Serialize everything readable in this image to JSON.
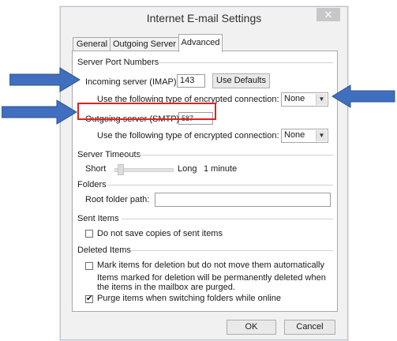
{
  "dialog": {
    "title": "Internet E-mail Settings",
    "close_glyph": "✕",
    "tabs": [
      {
        "label": "General"
      },
      {
        "label": "Outgoing Server"
      },
      {
        "label": "Advanced"
      }
    ],
    "active_tab": "Advanced"
  },
  "server_port_numbers": {
    "section_label": "Server Port Numbers",
    "incoming_label": "Incoming server (IMAP):",
    "incoming_value": "143",
    "use_defaults_label": "Use Defaults",
    "incoming_encryption_label": "Use the following type of encrypted connection:",
    "incoming_encryption_value": "None",
    "outgoing_label": "Outgoing server (SMTP):",
    "outgoing_value": "587",
    "outgoing_encryption_label": "Use the following type of encrypted connection:",
    "outgoing_encryption_value": "None"
  },
  "server_timeouts": {
    "section_label": "Server Timeouts",
    "short_label": "Short",
    "long_label": "Long",
    "value_label": "1 minute"
  },
  "folders": {
    "section_label": "Folders",
    "root_folder_label": "Root folder path:",
    "root_folder_value": ""
  },
  "sent_items": {
    "section_label": "Sent Items",
    "do_not_save_label": "Do not save copies of sent items",
    "do_not_save_checked": false
  },
  "deleted_items": {
    "section_label": "Deleted Items",
    "mark_label": "Mark items for deletion but do not move them automatically",
    "mark_checked": false,
    "note_line1": "Items marked for deletion will be permanently deleted when",
    "note_line2": "the items in the mailbox are purged.",
    "purge_label": "Purge items when switching folders while online",
    "purge_checked": true,
    "check_glyph": "✔"
  },
  "footer": {
    "ok_label": "OK",
    "cancel_label": "Cancel"
  },
  "annotations": {
    "arrow_color": "#3f6fbe",
    "highlight_color": "#e0231f"
  },
  "icons": [
    "close-icon",
    "chevron-down-icon",
    "checkmark-icon",
    "annotation-arrow-icon"
  ]
}
